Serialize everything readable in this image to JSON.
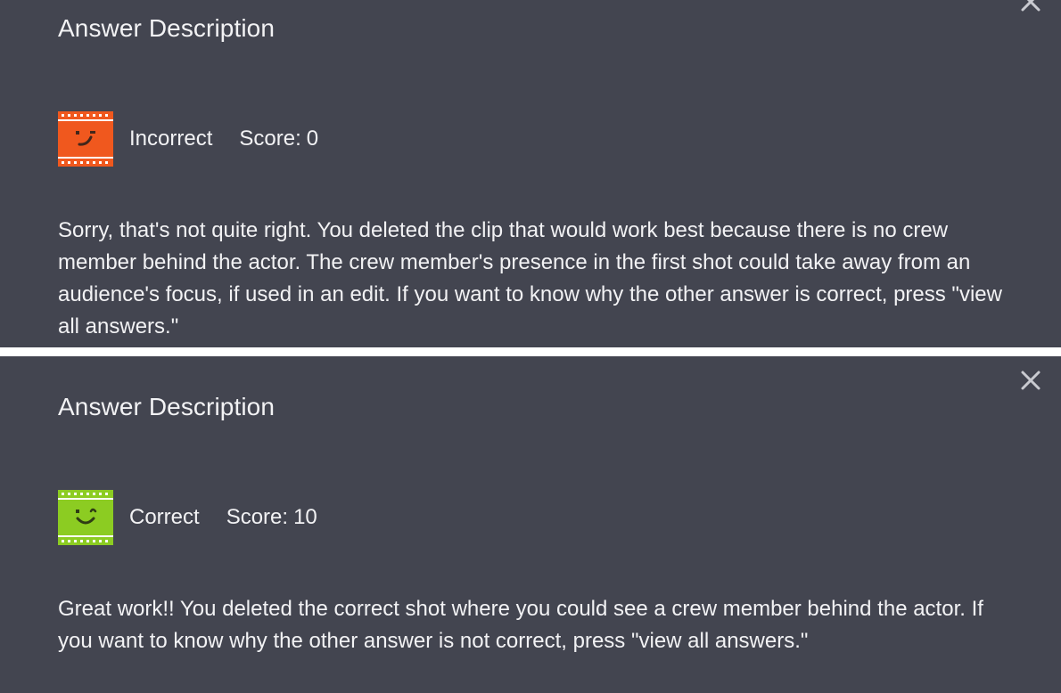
{
  "panels": [
    {
      "title": "Answer Description",
      "close_icon": "close-icon",
      "result": {
        "icon": "film-frown-icon",
        "icon_color": "#F0581E",
        "status": "Incorrect",
        "score_label": "Score:",
        "score_value": "0"
      },
      "description": "Sorry, that's not quite right. You deleted the clip that would work best because there is no crew member behind the actor. The crew member's presence in the first shot could take away from an audience's focus, if used in an edit. If you want to know why the other answer is correct, press \"view all answers.\""
    },
    {
      "title": "Answer Description",
      "close_icon": "close-icon",
      "result": {
        "icon": "film-smile-icon",
        "icon_color": "#8CCC22",
        "status": "Correct",
        "score_label": "Score:",
        "score_value": "10"
      },
      "description": "Great work!! You deleted the correct shot where you could see a crew member behind the actor. If you want to know why the other answer is not correct, press \"view all answers.\""
    }
  ],
  "colors": {
    "panel_background": "#434550",
    "separator": "#FFFFFF",
    "text": "#F2F2F4",
    "close_icon": "#C9CAD0"
  }
}
